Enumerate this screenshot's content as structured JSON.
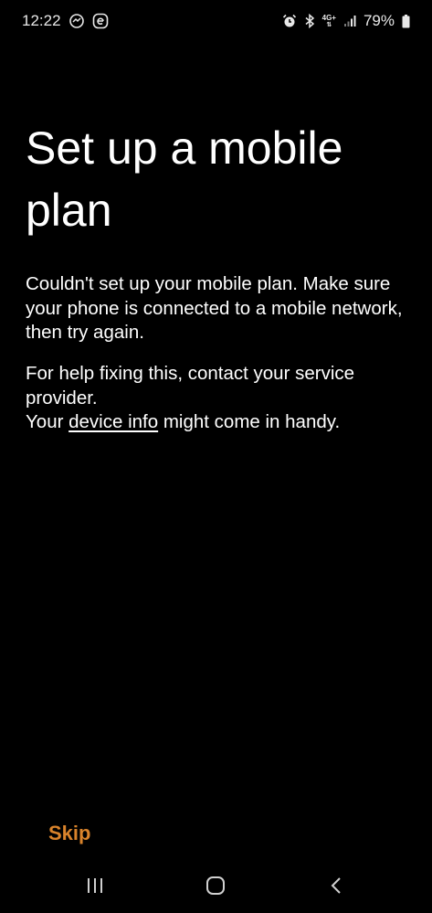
{
  "status_bar": {
    "time": "12:22",
    "network_label": "4G+",
    "battery": "79%",
    "left_icons": [
      "message-icon",
      "e-app-icon"
    ],
    "right_icons": [
      "alarm-icon",
      "bluetooth-icon",
      "network-4g-icon",
      "signal-icon",
      "battery-icon"
    ]
  },
  "page": {
    "title": "Set up a mobile plan",
    "message": "Couldn't set up your mobile plan. Make sure your phone is connected to a mobile network, then try again.",
    "help_line1": "For help fixing this, contact your service provider.",
    "help_prefix": "Your",
    "device_info_link": "device info",
    "help_suffix": "might come in handy."
  },
  "actions": {
    "skip_label": "Skip",
    "skip_color": "#d9832b"
  },
  "nav_bar": {
    "icons": [
      "recents-icon",
      "home-icon",
      "back-icon"
    ]
  }
}
